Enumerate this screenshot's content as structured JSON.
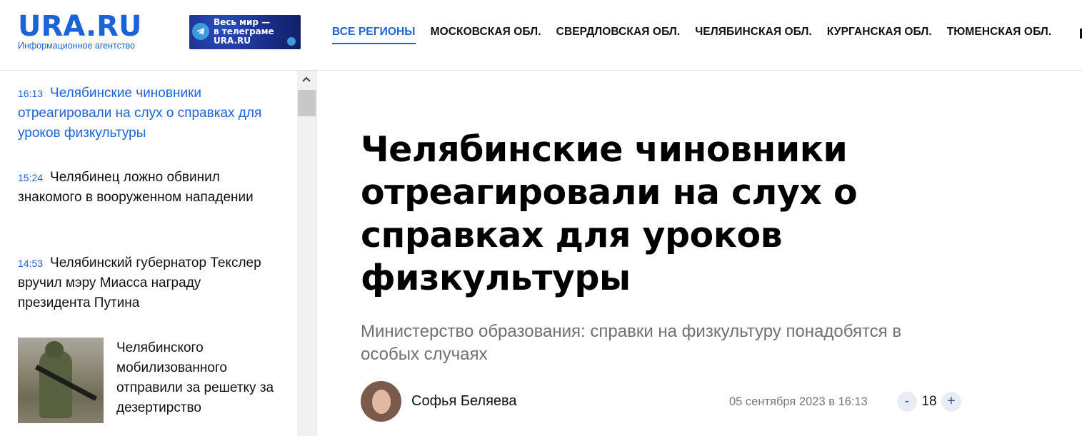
{
  "header": {
    "logo": "URA.RU",
    "logo_subtitle": "Информационное агентство",
    "promo": {
      "line1": "Весь мир —",
      "line2": "в телеграме",
      "line3": "URA.RU"
    },
    "nav": [
      {
        "label": "ВСЕ РЕГИОНЫ",
        "active": true
      },
      {
        "label": "МОСКОВСКАЯ ОБЛ."
      },
      {
        "label": "СВЕРДЛОВСКАЯ ОБЛ."
      },
      {
        "label": "ЧЕЛЯБИНСКАЯ ОБЛ."
      },
      {
        "label": "КУРГАНСКАЯ ОБЛ."
      },
      {
        "label": "ТЮМЕНСКАЯ ОБЛ."
      }
    ]
  },
  "sidebar": {
    "news": [
      {
        "time": "16:13",
        "title": "Челябинские чиновники отреагировали на слух о справках для уроков физкультуры",
        "active": true
      },
      {
        "time": "15:24",
        "title": "Челябинец ложно обвинил знакомого в вооруженном нападении"
      },
      {
        "time": "14:53",
        "title": "Челябинский губернатор Текслер вручил мэру Миасса награду президента Путина"
      }
    ],
    "image_news": {
      "title": "Челябинского мобилизованного отправили за решетку за дезертирство"
    }
  },
  "article": {
    "headline": "Челябинские чиновники отреагировали на слух о справках для уроков физкультуры",
    "lead": "Министерство образования: справки на физкультуру понадобятся в особых случаях",
    "author": "Софья Беляева",
    "date": "05 сентября 2023 в 16:13",
    "font_size_value": "18",
    "font_minus": "-",
    "font_plus": "+"
  },
  "colors": {
    "accent": "#1a64d8",
    "text": "#111111",
    "lead": "#707070"
  }
}
